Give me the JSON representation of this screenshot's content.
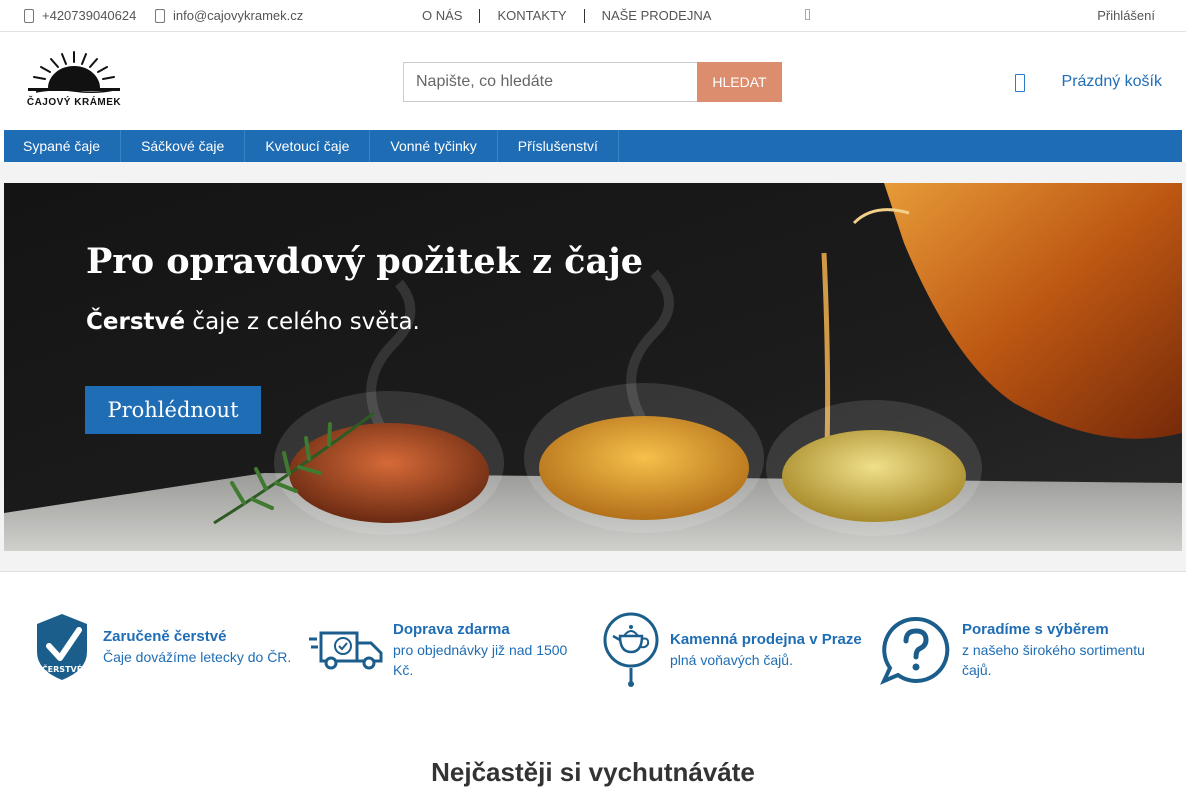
{
  "topbar": {
    "phone": "+420739040624",
    "email": "info@cajovykramek.cz",
    "nav": [
      "O NÁS",
      "KONTAKTY",
      "NAŠE PRODEJNA"
    ],
    "login": "Přihlášení"
  },
  "header": {
    "logo_text": "ČAJOVÝ KRÁMEK",
    "search_placeholder": "Napište, co hledáte",
    "search_button": "HLEDAT",
    "cart_label": "Prázdný košík"
  },
  "mainnav": [
    "Sypané čaje",
    "Sáčkové čaje",
    "Kvetoucí čaje",
    "Vonné tyčinky",
    "Příslušenství"
  ],
  "banner": {
    "headline": "Pro opravdový požitek z čaje",
    "subline_bold": "Čerstvé",
    "subline_rest": " čaje z celého světa.",
    "cta": "Prohlédnout"
  },
  "benefits": [
    {
      "icon": "fresh-check-icon",
      "badge": "ČERSTVÉ",
      "title": "Zaručeně čerstvé",
      "sub": "Čaje dovážíme letecky do ČR."
    },
    {
      "icon": "delivery-truck-icon",
      "title": "Doprava zdarma",
      "sub": "pro objednávky již nad 1500 Kč."
    },
    {
      "icon": "teapot-pin-icon",
      "title": "Kamenná prodejna v Praze",
      "sub": "plná voňavých čajů."
    },
    {
      "icon": "question-bubble-icon",
      "title": "Poradíme s výběrem",
      "sub": "z našeho širokého sortimentu čajů."
    }
  ],
  "section_title": "Nejčastěji si vychutnáváte",
  "colors": {
    "brand_blue": "#1e6cb4",
    "search_button": "#dc8d6d"
  }
}
